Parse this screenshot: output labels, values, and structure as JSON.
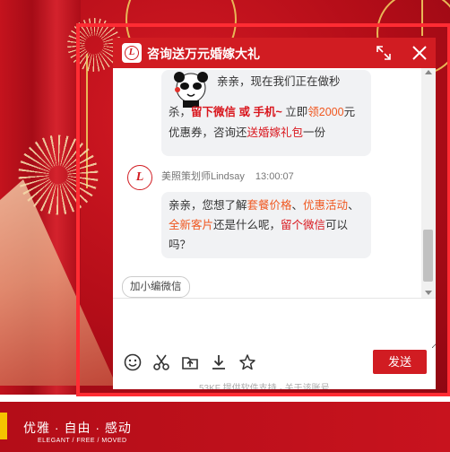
{
  "chat": {
    "title": "咨询送万元婚嫁大礼",
    "logo_letter": "L",
    "messages": [
      {
        "type": "promo",
        "line1": "亲亲，现在我们正在做秒",
        "line2_a": "杀，",
        "line2_b": "留下微信 或 手机~",
        "line2_c": " 立即",
        "line2_d": "领2000",
        "line2_e": "元",
        "line3_a": "优惠券，咨询还",
        "line3_b": "送婚嫁礼包",
        "line3_c": "一份"
      },
      {
        "type": "agent",
        "sender": "美照策划师Lindsay",
        "time": "13:00:07",
        "line1_a": "亲亲，您想了解",
        "line1_b": "套餐价格",
        "line1_c": "、",
        "line1_d": "优惠活动",
        "line1_e": "、",
        "line2_a": "全新客片",
        "line2_b": "还是什么呢，",
        "line2_c": "留个微信",
        "line2_d": "可以",
        "line3": "吗？"
      }
    ],
    "quick_reply": "加小编微信",
    "send_label": "发送",
    "powered_text": "53KF 提供软件支持 · 关于该账号"
  },
  "icons": [
    "logo-icon",
    "expand-icon",
    "close-icon",
    "emoji-icon",
    "scissors-icon",
    "folder-upload-icon",
    "download-icon",
    "star-icon"
  ],
  "footer": {
    "slogan": "优雅 · 自由 · 感动",
    "slogan_en": "ELEGANT / FREE / MOVED"
  },
  "colors": {
    "brand_red": "#d11c22",
    "highlight_red": "#ff2c33",
    "orange": "#f0571f"
  }
}
